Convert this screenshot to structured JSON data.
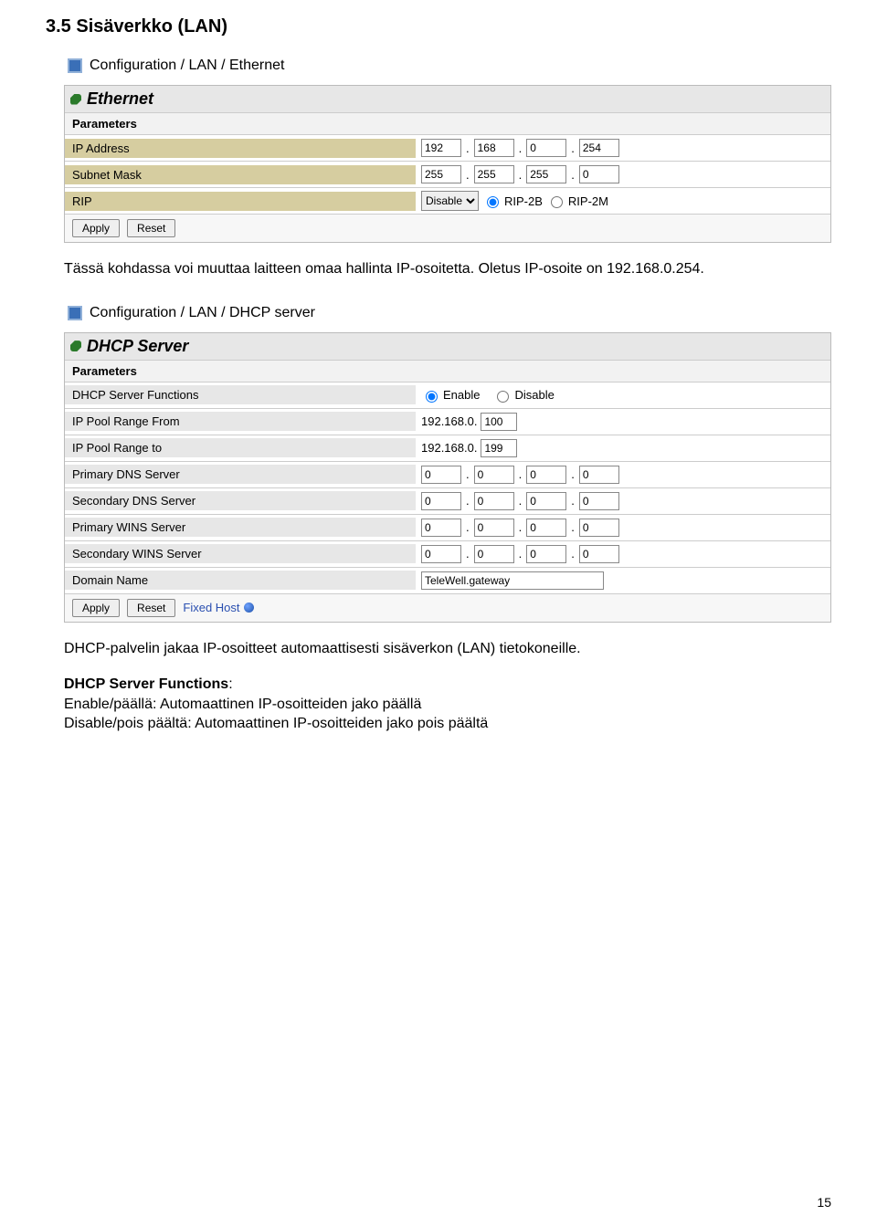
{
  "section_title": "3.5 Sisäverkko (LAN)",
  "bullet1": "Configuration / LAN / Ethernet",
  "ethernet": {
    "panel_label": "Ethernet",
    "parameters_label": "Parameters",
    "rows": {
      "ip_label": "IP Address",
      "ip": [
        "192",
        "168",
        "0",
        "254"
      ],
      "mask_label": "Subnet Mask",
      "mask": [
        "255",
        "255",
        "255",
        "0"
      ],
      "rip_label": "RIP",
      "rip_select": "Disable",
      "rip_opt1": "RIP-2B",
      "rip_opt2": "RIP-2M"
    },
    "apply": "Apply",
    "reset": "Reset"
  },
  "after_ethernet_text": "Tässä kohdassa voi muuttaa laitteen omaa hallinta IP-osoitetta. Oletus IP-osoite on 192.168.0.254.",
  "bullet2": "Configuration / LAN / DHCP server",
  "dhcp": {
    "panel_label": "DHCP Server",
    "parameters_label": "Parameters",
    "rows": {
      "func_label": "DHCP Server Functions",
      "func_enable": "Enable",
      "func_disable": "Disable",
      "pool_from_label": "IP Pool Range From",
      "pool_prefix": "192.168.0.",
      "pool_from": "100",
      "pool_to_label": "IP Pool Range to",
      "pool_to": "199",
      "pdns_label": "Primary DNS Server",
      "pdns": [
        "0",
        "0",
        "0",
        "0"
      ],
      "sdns_label": "Secondary DNS Server",
      "sdns": [
        "0",
        "0",
        "0",
        "0"
      ],
      "pwins_label": "Primary WINS Server",
      "pwins": [
        "0",
        "0",
        "0",
        "0"
      ],
      "swins_label": "Secondary WINS Server",
      "swins": [
        "0",
        "0",
        "0",
        "0"
      ],
      "domain_label": "Domain Name",
      "domain": "TeleWell.gateway"
    },
    "apply": "Apply",
    "reset": "Reset",
    "fixed_host": "Fixed Host"
  },
  "after_dhcp_text": "DHCP-palvelin jakaa IP-osoitteet automaattisesti sisäverkon (LAN) tietokoneille.",
  "functions_heading": "DHCP Server Functions",
  "functions_line1": "Enable/päällä: Automaattinen IP-osoitteiden jako päällä",
  "functions_line2": "Disable/pois päältä: Automaattinen IP-osoitteiden jako pois päältä",
  "page_number": "15"
}
